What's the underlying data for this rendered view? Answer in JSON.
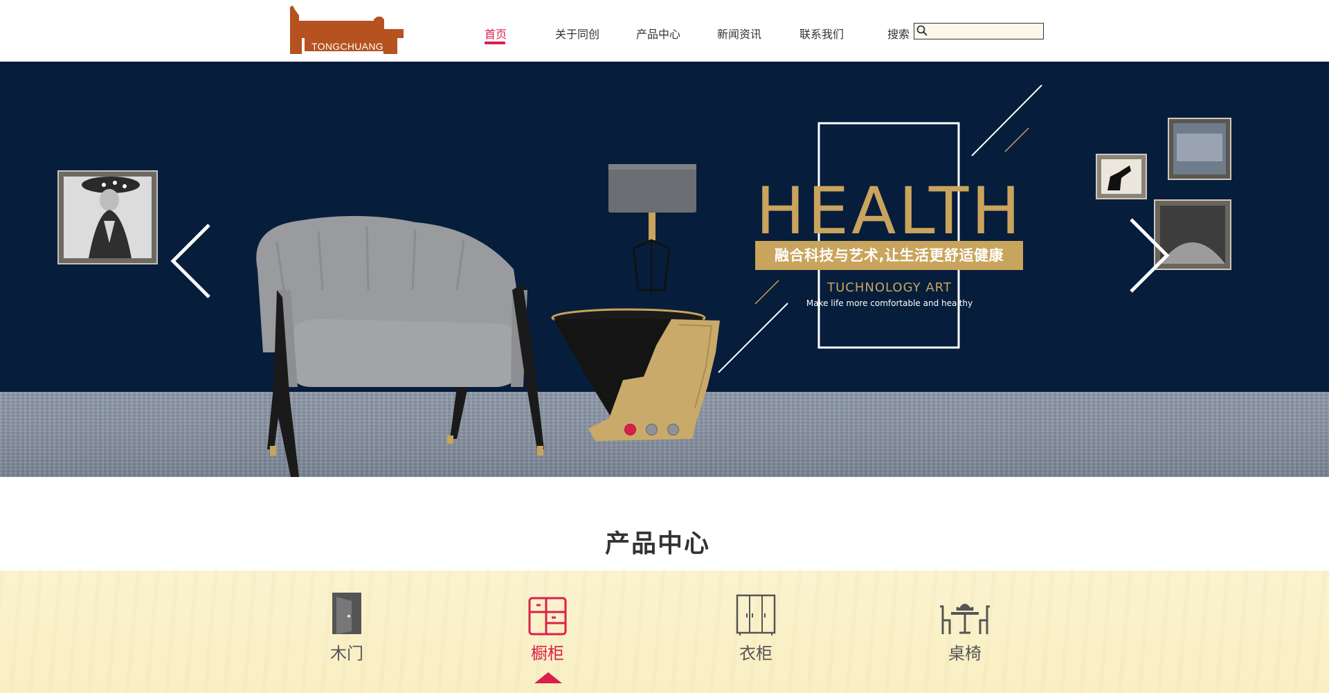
{
  "brand": {
    "logo_text": "TONGCHUANG",
    "color": "#b5521f"
  },
  "nav": {
    "items": [
      {
        "label": "首页",
        "active": true
      },
      {
        "label": "关于同创",
        "active": false
      },
      {
        "label": "产品中心",
        "active": false
      },
      {
        "label": "新闻资讯",
        "active": false
      },
      {
        "label": "联系我们",
        "active": false
      }
    ],
    "accent": "#d9204a"
  },
  "search": {
    "label": "搜索",
    "value": "",
    "icon": "search-icon"
  },
  "banner": {
    "headline": "HEALTH",
    "tagline": "融合科技与艺术,让生活更舒适健康",
    "subtitle": "TUCHNOLOGY ART",
    "caption": "Make life more comfortable and healthy",
    "prev_icon": "chevron-left-icon",
    "next_icon": "chevron-right-icon",
    "slides_total": 3,
    "active_slide": 1,
    "gold": "#c9a45c",
    "navy": "#071d3c"
  },
  "products": {
    "title": "产品中心",
    "items": [
      {
        "label": "木门",
        "icon": "door-icon",
        "active": false
      },
      {
        "label": "橱柜",
        "icon": "cabinet-icon",
        "active": true
      },
      {
        "label": "衣柜",
        "icon": "wardrobe-icon",
        "active": false
      },
      {
        "label": "桌椅",
        "icon": "table-chairs-icon",
        "active": false
      }
    ]
  }
}
